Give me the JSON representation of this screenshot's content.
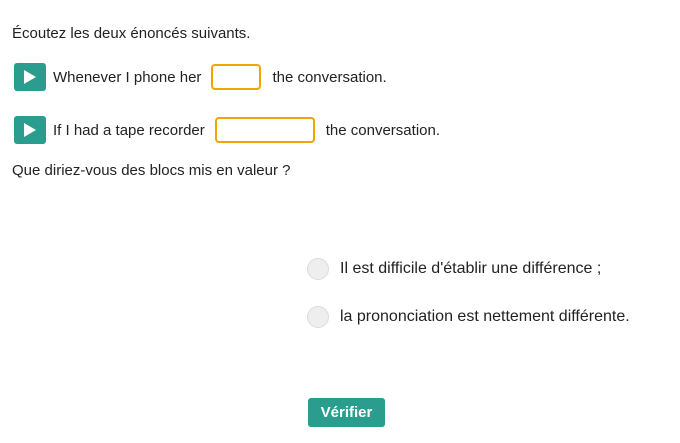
{
  "instruction": "Écoutez les deux énoncés suivants.",
  "sentences": [
    {
      "play_icon": "play-icon",
      "text_before": "Whenever I phone her",
      "blank_value": "",
      "text_after": "the conversation."
    },
    {
      "play_icon": "play-icon",
      "text_before": "If I had a tape recorder",
      "blank_value": "",
      "text_after": "the conversation."
    }
  ],
  "question": "Que diriez-vous des blocs mis en valeur ?",
  "options": [
    {
      "label": "Il est difficile d'établir une différence ;"
    },
    {
      "label": "la prononciation est nettement différente."
    }
  ],
  "verify_button": "Vérifier",
  "colors": {
    "accent": "#2a9d8f",
    "blank_border": "#f0a500",
    "radio_fill": "#eeeeee"
  }
}
